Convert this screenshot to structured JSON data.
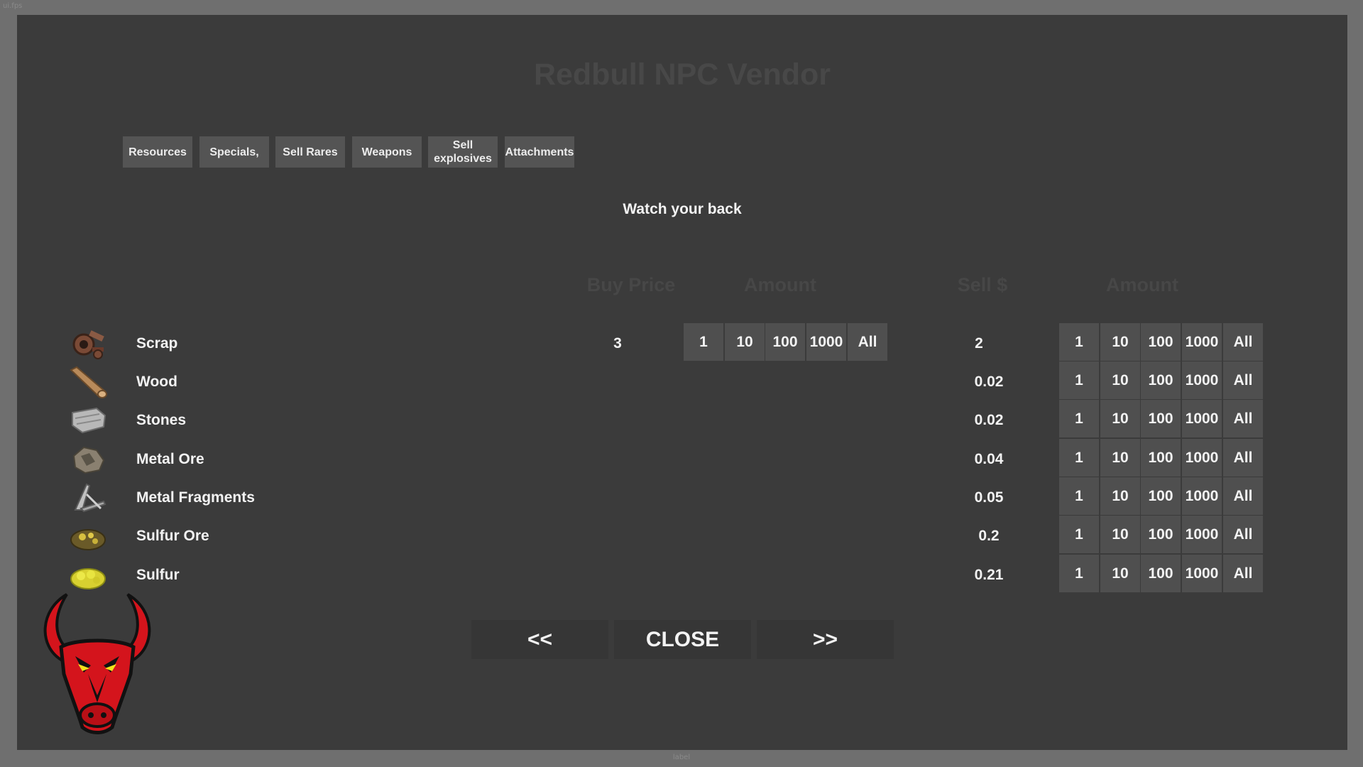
{
  "corner_label": "ui.fps",
  "footer_label": "label",
  "title": "Redbull NPC Vendor",
  "tabs": [
    {
      "label": "Resources"
    },
    {
      "label": "Specials,"
    },
    {
      "label": "Sell Rares"
    },
    {
      "label": "Weapons"
    },
    {
      "label": "Sell explosives"
    },
    {
      "label": "Attachments"
    }
  ],
  "subtitle": "Watch your back",
  "columns": {
    "buy_price": "Buy Price",
    "buy_amount": "Amount",
    "sell_price": "Sell $",
    "sell_amount": "Amount"
  },
  "amount_options": [
    "1",
    "10",
    "100",
    "1000",
    "All"
  ],
  "items": [
    {
      "name": "Scrap",
      "icon": "scrap-icon",
      "buy_price": "3",
      "sell_price": "2"
    },
    {
      "name": "Wood",
      "icon": "wood-icon",
      "buy_price": "",
      "sell_price": "0.02"
    },
    {
      "name": "Stones",
      "icon": "stones-icon",
      "buy_price": "",
      "sell_price": "0.02"
    },
    {
      "name": "Metal Ore",
      "icon": "metal-ore-icon",
      "buy_price": "",
      "sell_price": "0.04"
    },
    {
      "name": "Metal Fragments",
      "icon": "metal-fragments-icon",
      "buy_price": "",
      "sell_price": "0.05"
    },
    {
      "name": "Sulfur Ore",
      "icon": "sulfur-ore-icon",
      "buy_price": "",
      "sell_price": "0.2"
    },
    {
      "name": "Sulfur",
      "icon": "sulfur-icon",
      "buy_price": "",
      "sell_price": "0.21"
    }
  ],
  "nav": {
    "prev": "<<",
    "close": "CLOSE",
    "next": ">>"
  },
  "colors": {
    "panel": "#3b3b3b",
    "button": "#4f4f4f",
    "logo_red": "#d4141c"
  }
}
